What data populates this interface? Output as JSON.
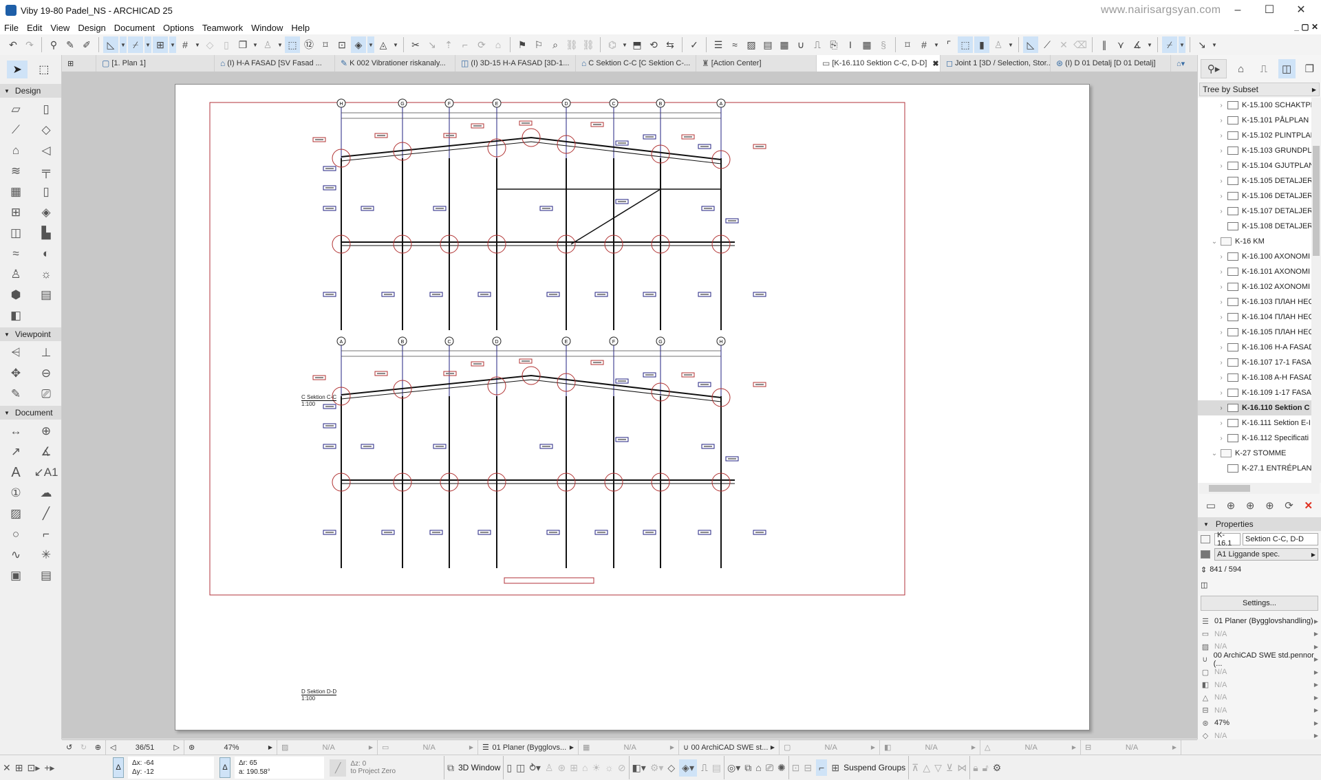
{
  "window": {
    "title": "Viby 19-80 Padel_NS - ARCHICAD 25",
    "watermark": "www.nairisargsyan.com",
    "controls": {
      "minimize": "–",
      "maximize": "☐",
      "close": "✕"
    },
    "mdi_controls": "_ ▢ ✕"
  },
  "menu": [
    "File",
    "Edit",
    "View",
    "Design",
    "Document",
    "Options",
    "Teamwork",
    "Window",
    "Help"
  ],
  "tabs": [
    {
      "label": "[1. Plan 1]",
      "icon": "floor-plan-icon",
      "active": false
    },
    {
      "label": "(I) H-A FASAD  [SV Fasad ...",
      "icon": "elevation-icon",
      "active": false
    },
    {
      "label": "K 002 Vibrationer riskanaly...",
      "icon": "document-icon",
      "active": false
    },
    {
      "label": "(I) 3D-15 H-A FASAD [3D-1...",
      "icon": "3d-document-icon",
      "active": false
    },
    {
      "label": "C Sektion C-C [C Sektion C-...",
      "icon": "section-icon",
      "active": false
    },
    {
      "label": "[Action Center]",
      "icon": "lighthouse-icon",
      "active": false
    },
    {
      "label": "[K-16.110 Sektion C-C, D-D]",
      "icon": "layout-icon",
      "active": true
    },
    {
      "label": "Joint 1 [3D / Selection, Stor...",
      "icon": "3d-icon",
      "active": false
    },
    {
      "label": "(I) D 01 Detalj [D 01 Detalj]",
      "icon": "detail-icon",
      "active": false
    }
  ],
  "toolbox": {
    "groups": [
      {
        "name": "Design",
        "tools": [
          "wall",
          "column",
          "beam",
          "slab",
          "roof",
          "shell",
          "stair",
          "railing",
          "curtain-wall",
          "door",
          "window",
          "skylight",
          "corner-window",
          "zone",
          "mesh",
          "morph",
          "object",
          "lamp",
          "wall-end",
          "curtain-panel",
          "opening"
        ]
      },
      {
        "name": "Viewpoint",
        "tools": [
          "section",
          "elevation",
          "interior-elevation",
          "worksheet",
          "detail",
          "camera"
        ]
      },
      {
        "name": "Document",
        "tools": [
          "dimension",
          "level-dimension",
          "radial-dimension",
          "angle-dimension",
          "text",
          "label",
          "marker",
          "revision-cloud",
          "fill",
          "line",
          "circle",
          "polyline",
          "spline",
          "hotspot",
          "figure",
          "drawing"
        ]
      }
    ]
  },
  "drawing": {
    "upper": {
      "title": "C Sektion C-C",
      "scale": "1:100",
      "grid": [
        "H",
        "G",
        "F",
        "E",
        "D",
        "C",
        "B",
        "A"
      ]
    },
    "lower": {
      "title": "D Sektion D-D",
      "scale": "1:100",
      "grid": [
        "A",
        "B",
        "C",
        "D",
        "E",
        "F",
        "G",
        "H"
      ]
    }
  },
  "navigator": {
    "view_mode": "Tree by Subset",
    "items": [
      {
        "label": "K-15.100 SCHAKTPL",
        "type": "layout",
        "expandable": true,
        "level": 2
      },
      {
        "label": "K-15.101 PÅLPLAN",
        "type": "layout",
        "expandable": true,
        "level": 2
      },
      {
        "label": "K-15.102 PLINTPLAN",
        "type": "layout",
        "expandable": true,
        "level": 2
      },
      {
        "label": "K-15.103 GRUNDPL",
        "type": "layout",
        "expandable": true,
        "level": 2
      },
      {
        "label": "K-15.104 GJUTPLAN",
        "type": "layout",
        "expandable": true,
        "level": 2
      },
      {
        "label": "K-15.105 DETALJER",
        "type": "layout",
        "expandable": true,
        "level": 2
      },
      {
        "label": "K-15.106 DETALJER",
        "type": "layout",
        "expandable": true,
        "level": 2
      },
      {
        "label": "K-15.107 DETALJER",
        "type": "layout",
        "expandable": true,
        "level": 2
      },
      {
        "label": "K-15.108 DETALJER",
        "type": "layout",
        "expandable": false,
        "level": 2
      },
      {
        "label": "K-16 KM",
        "type": "folder",
        "expandable": true,
        "expanded": true,
        "level": 1
      },
      {
        "label": "K-16.100 AXONOMI",
        "type": "layout",
        "expandable": true,
        "level": 2
      },
      {
        "label": "K-16.101 AXONOMI",
        "type": "layout",
        "expandable": true,
        "level": 2
      },
      {
        "label": "K-16.102 AXONOMI",
        "type": "layout",
        "expandable": true,
        "level": 2
      },
      {
        "label": "K-16.103 ПЛАН НЕС",
        "type": "layout",
        "expandable": true,
        "level": 2
      },
      {
        "label": "K-16.104 ПЛАН НЕС",
        "type": "layout",
        "expandable": true,
        "level": 2
      },
      {
        "label": "K-16.105 ПЛАН НЕС",
        "type": "layout",
        "expandable": true,
        "level": 2
      },
      {
        "label": "K-16.106 H-A FASAD",
        "type": "layout",
        "expandable": true,
        "level": 2
      },
      {
        "label": "K-16.107 17-1 FASAD",
        "type": "layout",
        "expandable": true,
        "level": 2
      },
      {
        "label": "K-16.108 A-H FASAD",
        "type": "layout",
        "expandable": true,
        "level": 2
      },
      {
        "label": "K-16.109 1-17 FASAD",
        "type": "layout",
        "expandable": true,
        "level": 2
      },
      {
        "label": "K-16.110 Sektion C",
        "type": "layout",
        "expandable": true,
        "level": 2,
        "selected": true
      },
      {
        "label": "K-16.111 Sektion E-I",
        "type": "layout",
        "expandable": true,
        "level": 2
      },
      {
        "label": "K-16.112 Specificati",
        "type": "layout",
        "expandable": true,
        "level": 2
      },
      {
        "label": "K-27 STOMME",
        "type": "folder",
        "expandable": true,
        "expanded": true,
        "level": 1
      },
      {
        "label": "K-27.1 ENTRÉPLAN",
        "type": "layout",
        "expandable": false,
        "level": 2
      }
    ]
  },
  "properties": {
    "header": "Properties",
    "id": "K-16.1",
    "name": "Sektion C-C, D-D",
    "master": "A1 Liggande spec.",
    "size": "841 / 594",
    "settings_label": "Settings...",
    "list": [
      {
        "icon": "layer-combination-icon",
        "value": "01 Planer (Bygglovshandling)",
        "enabled": true
      },
      {
        "icon": "dimension-icon",
        "value": "N/A",
        "enabled": false
      },
      {
        "icon": "scale-icon",
        "value": "N/A",
        "enabled": false
      },
      {
        "icon": "pen-set-icon",
        "value": "00 ArchiCAD SWE std.pennor (...",
        "enabled": true
      },
      {
        "icon": "model-view-icon",
        "value": "N/A",
        "enabled": false
      },
      {
        "icon": "override-icon",
        "value": "N/A",
        "enabled": false
      },
      {
        "icon": "renovation-icon",
        "value": "N/A",
        "enabled": false
      },
      {
        "icon": "structure-icon",
        "value": "N/A",
        "enabled": false
      },
      {
        "icon": "zoom-icon",
        "value": "47%",
        "enabled": true
      },
      {
        "icon": "3d-style-icon",
        "value": "N/A",
        "enabled": false
      }
    ]
  },
  "statusbar": {
    "page": "36/51",
    "zoom": "47%",
    "cells": [
      {
        "icon": "scale-icon",
        "value": "N/A"
      },
      {
        "icon": "dimension-icon",
        "value": "N/A"
      },
      {
        "icon": "layer-combination-icon",
        "value": "01 Planer (Bygglovs..."
      },
      {
        "icon": "hatch-icon",
        "value": "N/A"
      },
      {
        "icon": "pen-set-icon",
        "value": "00 ArchiCAD SWE st..."
      },
      {
        "icon": "model-view-icon",
        "value": "N/A"
      },
      {
        "icon": "override-icon",
        "value": "N/A"
      },
      {
        "icon": "renovation-icon",
        "value": "N/A"
      },
      {
        "icon": "structure-icon",
        "value": "N/A"
      }
    ]
  },
  "coords": {
    "dx": "Δx: -64",
    "dy": "Δy: -12",
    "dr": "Δr: 65",
    "angle": "a: 190.58°",
    "dz": "Δz: 0",
    "ref": "to Project Zero"
  },
  "bottom": {
    "window_3d": "3D Window",
    "suspend_groups": "Suspend Groups"
  }
}
